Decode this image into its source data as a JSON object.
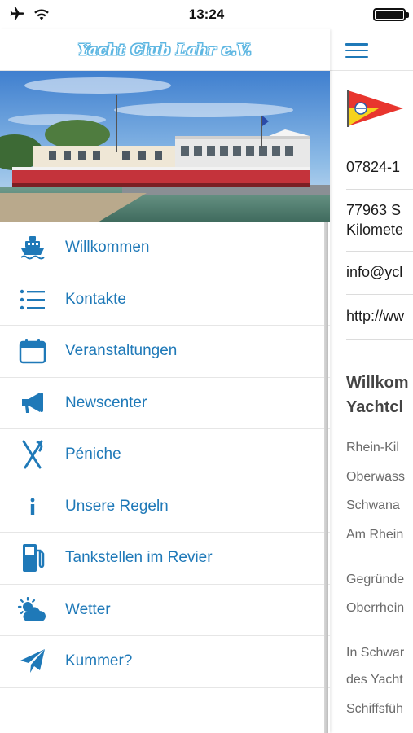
{
  "status_bar": {
    "time": "13:24",
    "battery_level": 1.0
  },
  "drawer": {
    "club_title": "Yacht Club Lahr e.V.",
    "hero_image": "Red-and-white riverboat moored at a pier on the Rhine under a blue sky",
    "menu": [
      {
        "label": "Willkommen",
        "icon": "ship-icon"
      },
      {
        "label": "Kontakte",
        "icon": "list-icon"
      },
      {
        "label": "Veranstaltungen",
        "icon": "calendar-icon"
      },
      {
        "label": "Newscenter",
        "icon": "megaphone-icon"
      },
      {
        "label": "Péniche",
        "icon": "fork-knife-icon"
      },
      {
        "label": "Unsere Regeln",
        "icon": "info-icon"
      },
      {
        "label": "Tankstellen im Revier",
        "icon": "fuel-pump-icon"
      },
      {
        "label": "Wetter",
        "icon": "weather-icon"
      },
      {
        "label": "Kummer?",
        "icon": "paper-plane-icon"
      }
    ]
  },
  "content": {
    "phone": "07824-1",
    "address_line1": "77963 S",
    "address_line2": "Kilomete",
    "email": "info@ycl",
    "website": "http://ww",
    "heading_line1": "Willkom",
    "heading_line2": "Yachtcl",
    "paragraph1": [
      "Rhein-Kil",
      "Oberwass",
      "Schwana",
      "Am Rhein"
    ],
    "paragraph2": [
      "Gegründe",
      "Oberrhein"
    ],
    "paragraph3": [
      "In Schwar",
      "des Yacht",
      "Schiffsfüh"
    ]
  },
  "colors": {
    "accent": "#1f79b8",
    "logo": "#5fb7e2",
    "pennant_red": "#e8352e",
    "pennant_yellow": "#f5d21c"
  }
}
